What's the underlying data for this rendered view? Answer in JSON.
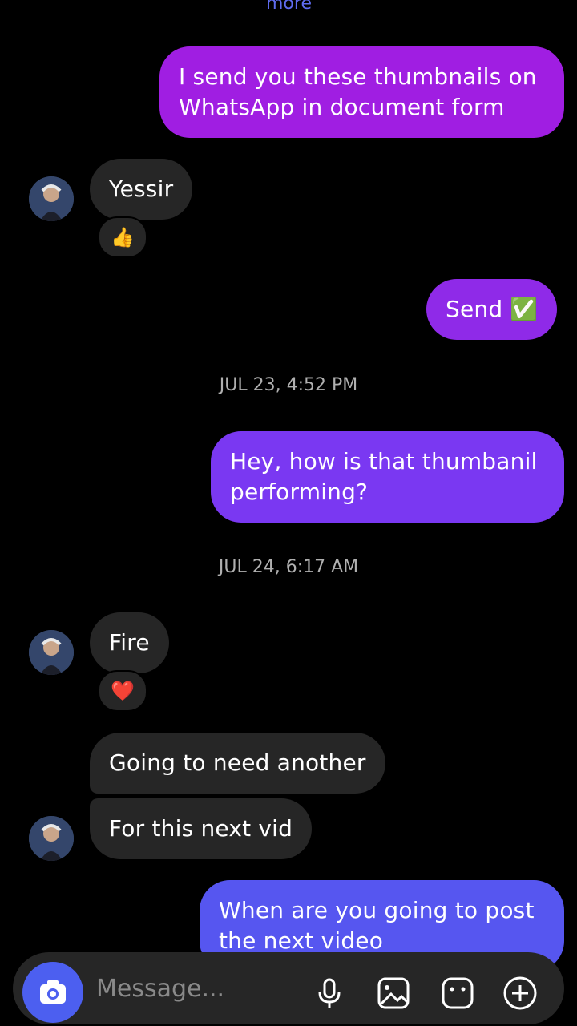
{
  "top_link": "more",
  "messages": [
    {
      "text": "I send you these thumbnails on WhatsApp in document form"
    },
    {
      "text": "Yessir",
      "reaction": "👍"
    },
    {
      "text": "Send ✅"
    },
    {
      "text": "Hey, how is that thumbanil performing?"
    },
    {
      "text": "Fire",
      "reaction": "❤️"
    },
    {
      "text": "Going to need another"
    },
    {
      "text": "For this next vid"
    },
    {
      "text": "When are you going to post the next video"
    }
  ],
  "timestamps": [
    "JUL 23, 4:52 PM",
    "JUL 24, 6:17 AM"
  ],
  "composer": {
    "placeholder": "Message...",
    "camera_icon": "camera-icon",
    "tools": [
      "microphone-icon",
      "image-icon",
      "sticker-icon",
      "plus-icon"
    ]
  },
  "colors": {
    "background": "#000000",
    "incoming_bubble": "#262626",
    "outgoing_gradient": [
      "#a01ee2",
      "#8a2cf0",
      "#7a38f2",
      "#5656f0"
    ],
    "accent": "#4c5ff0"
  }
}
